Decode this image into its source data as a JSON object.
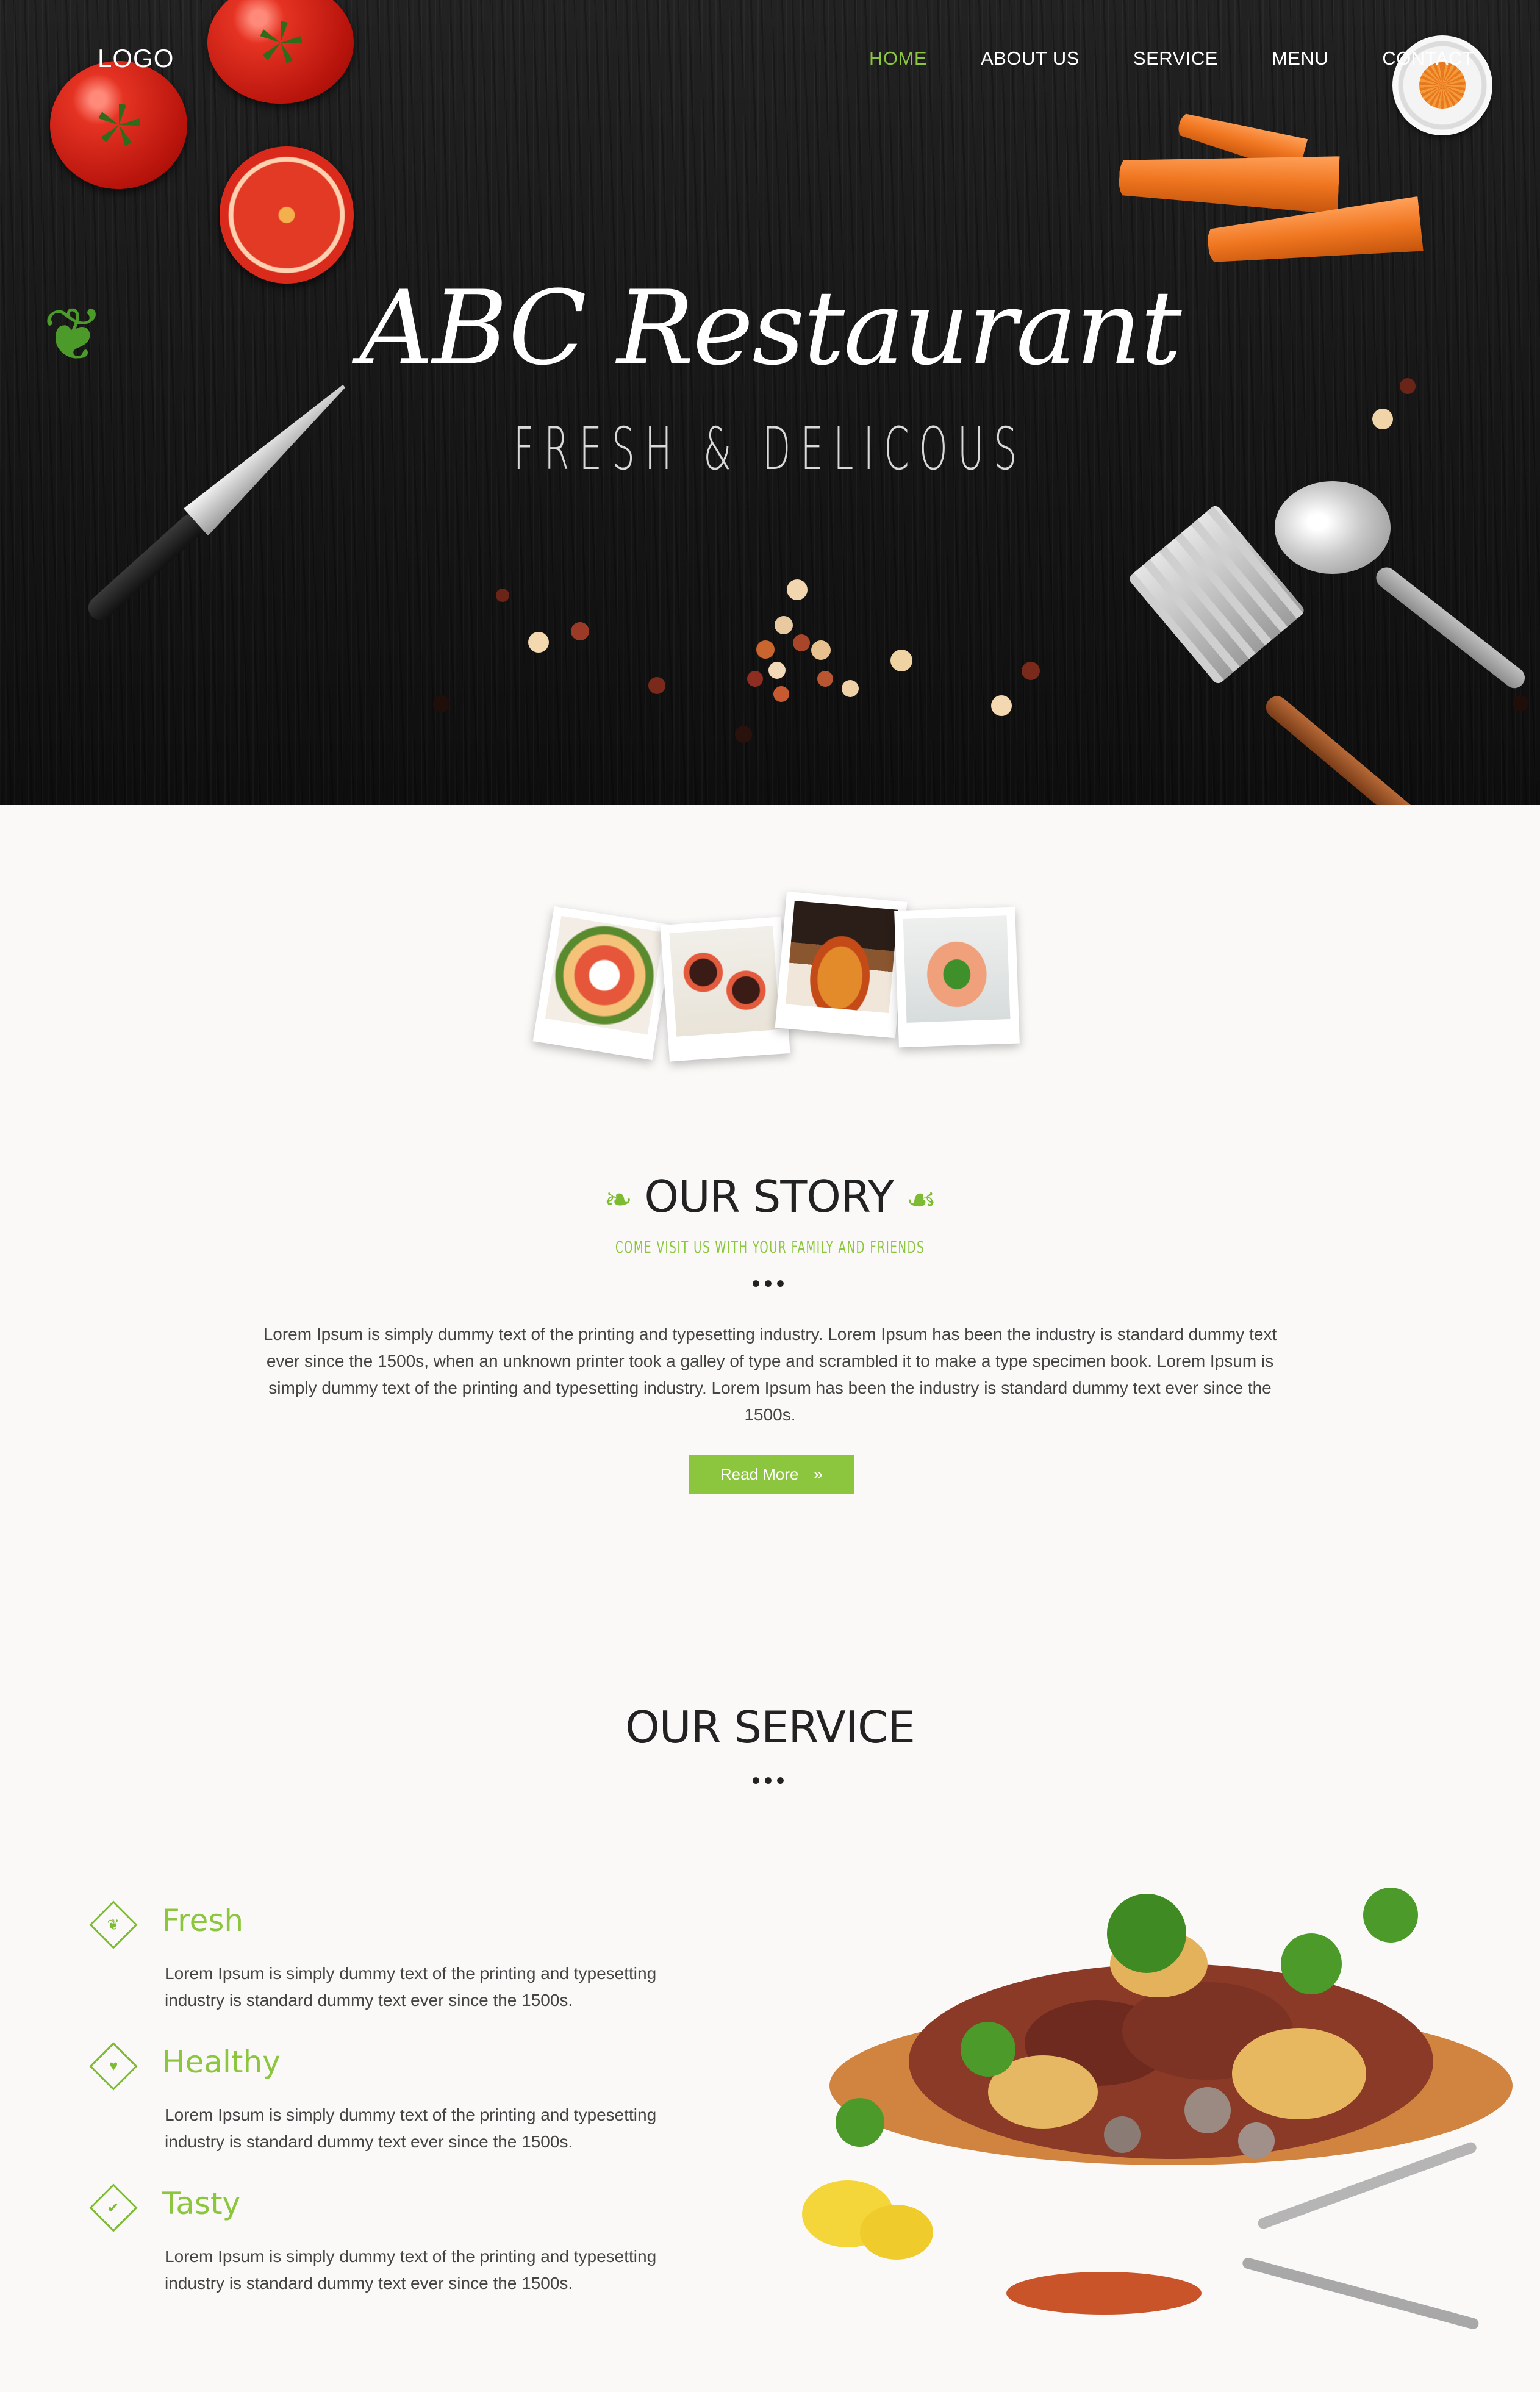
{
  "header": {
    "logo": "LOGO",
    "nav": [
      {
        "label": "HOME",
        "active": true
      },
      {
        "label": "ABOUT US",
        "active": false
      },
      {
        "label": "SERVICE",
        "active": false
      },
      {
        "label": "MENU",
        "active": false
      },
      {
        "label": "CONTACT",
        "active": false
      }
    ]
  },
  "hero": {
    "title": "ABC Restaurant",
    "subtitle": "FRESH & DELICOUS"
  },
  "story": {
    "title": "OUR STORY",
    "subtitle": "COME VISIT US WITH YOUR FAMILY AND FRIENDS",
    "dots": "•••",
    "text": "Lorem Ipsum is simply dummy text of the printing and typesetting industry. Lorem Ipsum has been the industry is standard dummy text ever since the 1500s, when an unknown printer took a galley of type and scrambled it to make a type specimen book. Lorem Ipsum is simply dummy text of the printing and typesetting industry. Lorem Ipsum has been the industry is standard dummy text ever since the 1500s.",
    "button": "Read More",
    "button_arrow": "»"
  },
  "service": {
    "title": "OUR SERVICE",
    "dots": "•••",
    "items": [
      {
        "title": "Fresh",
        "text": "Lorem Ipsum is simply dummy text of the printing and typesetting industry is standard dummy text ever since the 1500s.",
        "icon": "leaf-icon"
      },
      {
        "title": "Healthy",
        "text": "Lorem Ipsum is simply dummy text of the printing and typesetting industry is standard dummy text ever since the 1500s.",
        "icon": "heart-icon"
      },
      {
        "title": "Tasty",
        "text": "Lorem Ipsum is simply dummy text of the printing and typesetting industry is standard dummy text ever since the 1500s.",
        "icon": "thumbs-up-icon"
      }
    ]
  },
  "colors": {
    "accent": "#8cc63f",
    "hero_bg": "#161616",
    "page_bg": "#faf9f7"
  }
}
